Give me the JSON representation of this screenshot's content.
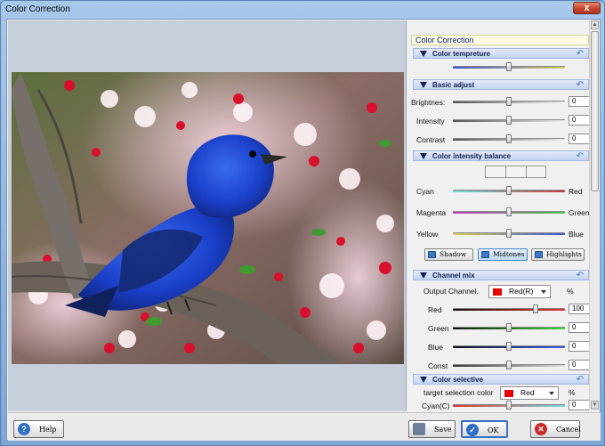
{
  "window": {
    "title": "Color Correction",
    "close_glyph": "x"
  },
  "panel": {
    "header": "Color Correction",
    "sections": {
      "temperature": "Color tempreture",
      "basic": "Basic adjust",
      "intensity": "Color intensity balance",
      "mix": "Channel mix",
      "selective": "Color selective"
    },
    "basic": {
      "brightness": {
        "label": "Brightnes:",
        "value": "0"
      },
      "intensity": {
        "label": "Intensity",
        "value": "0"
      },
      "contrast": {
        "label": "Contrast",
        "value": "0"
      }
    },
    "balance": {
      "cyan": "Cyan",
      "red": "Red",
      "magenta": "Magenta",
      "green": "Green",
      "yellow": "Yellow",
      "blue": "Blue"
    },
    "tones": {
      "shadow": "Shadow",
      "midtones": "Midtones",
      "highlights": "Highlights"
    },
    "mix": {
      "output_label": "Output Channel.",
      "output_value": "Red(R)",
      "percent": "%",
      "red": {
        "label": "Red",
        "value": "100"
      },
      "green": {
        "label": "Green",
        "value": "0"
      },
      "blue": {
        "label": "Blue",
        "value": "0"
      },
      "const": {
        "label": "Const",
        "value": "0"
      }
    },
    "selective": {
      "target_label": "target selection color",
      "target_value": "Red",
      "percent": "%",
      "cyan": {
        "label": "Cyan(C)",
        "value": "0"
      }
    }
  },
  "buttons": {
    "help": "Help",
    "save": "Save",
    "ok": "OK",
    "cancel": "Cancel",
    "help_glyph": "?",
    "ok_glyph": "✓",
    "cancel_glyph": "✕",
    "undo_glyph": "↶"
  },
  "colors": {
    "accent": "#3b6fc9",
    "red_swatch": "#e60000",
    "title_bar": "#8fb4dc"
  },
  "icons": [
    "close-icon",
    "undo-icon",
    "collapse-triangle-icon",
    "help-icon",
    "save-icon",
    "ok-check-icon",
    "cancel-icon"
  ]
}
